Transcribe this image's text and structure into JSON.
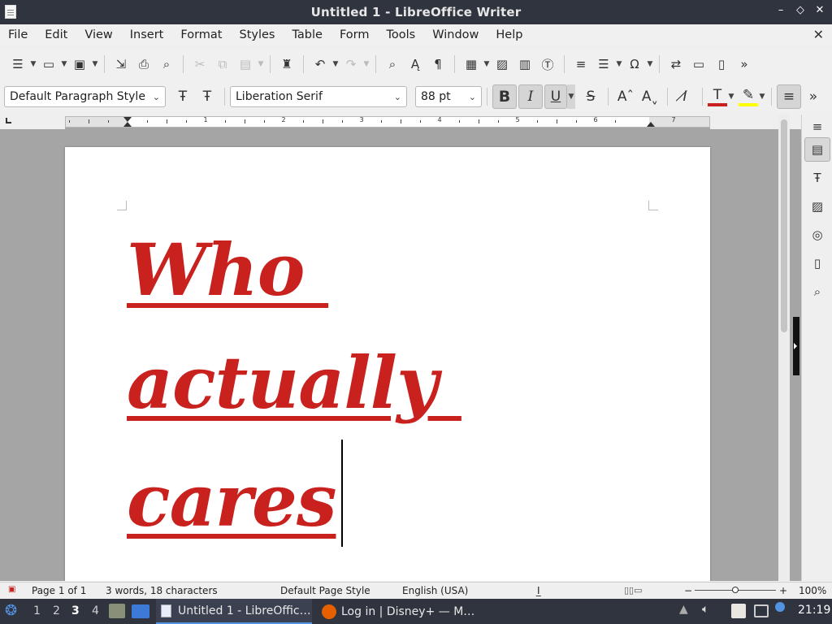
{
  "window": {
    "title": "Untitled 1 - LibreOffice Writer",
    "controls": [
      "–",
      "◇",
      "✕"
    ]
  },
  "menu": [
    "File",
    "Edit",
    "View",
    "Insert",
    "Format",
    "Styles",
    "Table",
    "Form",
    "Tools",
    "Window",
    "Help"
  ],
  "menu_close": "✕",
  "toolbar2": {
    "paragraph_style": "Default Paragraph Style",
    "font_name": "Liberation Serif",
    "font_size": "88 pt",
    "bold": "B",
    "italic": "I",
    "underline": "U",
    "strike": "S"
  },
  "ruler": {
    "numbers": [
      "1",
      "2",
      "3",
      "4",
      "5",
      "6",
      "7"
    ]
  },
  "document": {
    "lines": [
      "Who ",
      "actually ",
      "cares"
    ],
    "text_color": "#c9211e"
  },
  "status": {
    "page": "Page 1 of 1",
    "words": "3 words, 18 characters",
    "page_style": "Default Page Style",
    "language": "English (USA)",
    "zoom": "100%",
    "zoom_minus": "−",
    "zoom_plus": "+"
  },
  "taskbar": {
    "workspaces": [
      "1",
      "2",
      "3",
      "4"
    ],
    "current_workspace": "3",
    "tasks": [
      "Untitled 1 - LibreOffic…",
      "Log in | Disney+ — M…"
    ],
    "clock": "21:19"
  },
  "colors": {
    "font_color": "#c9211e",
    "highlight": "#ffff00",
    "accent": "#5294e2"
  }
}
